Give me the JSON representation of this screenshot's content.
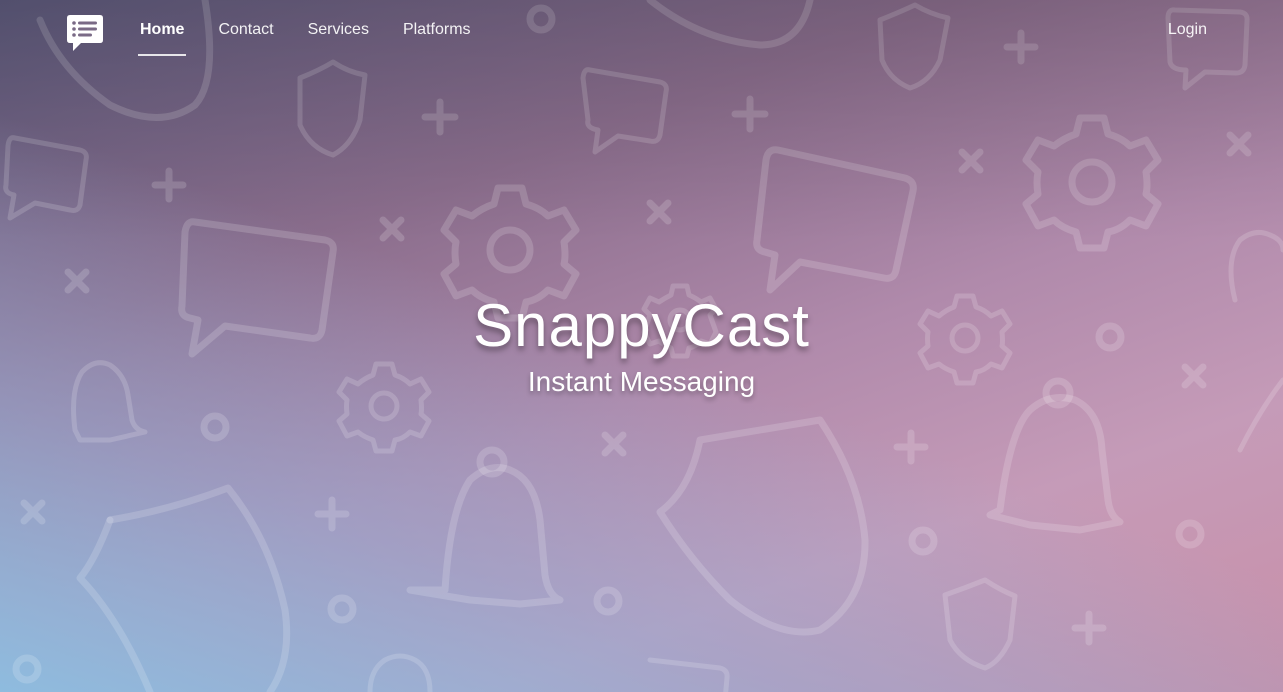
{
  "navbar": {
    "logo_icon": "chat-bubble-list-icon",
    "links": [
      {
        "label": "Home",
        "active": true
      },
      {
        "label": "Contact",
        "active": false
      },
      {
        "label": "Services",
        "active": false
      },
      {
        "label": "Platforms",
        "active": false
      }
    ],
    "login_label": "Login"
  },
  "hero": {
    "title": "SnappyCast",
    "subtitle": "Instant Messaging",
    "background_pattern_icons": [
      "chat-bubble-icon",
      "gear-icon",
      "bell-icon",
      "shield-icon",
      "plus-icon",
      "x-icon",
      "ring-icon"
    ],
    "gradient_colors": [
      "#5d5a7c",
      "#b08aab",
      "#c98fa8",
      "#8cbee1"
    ]
  }
}
